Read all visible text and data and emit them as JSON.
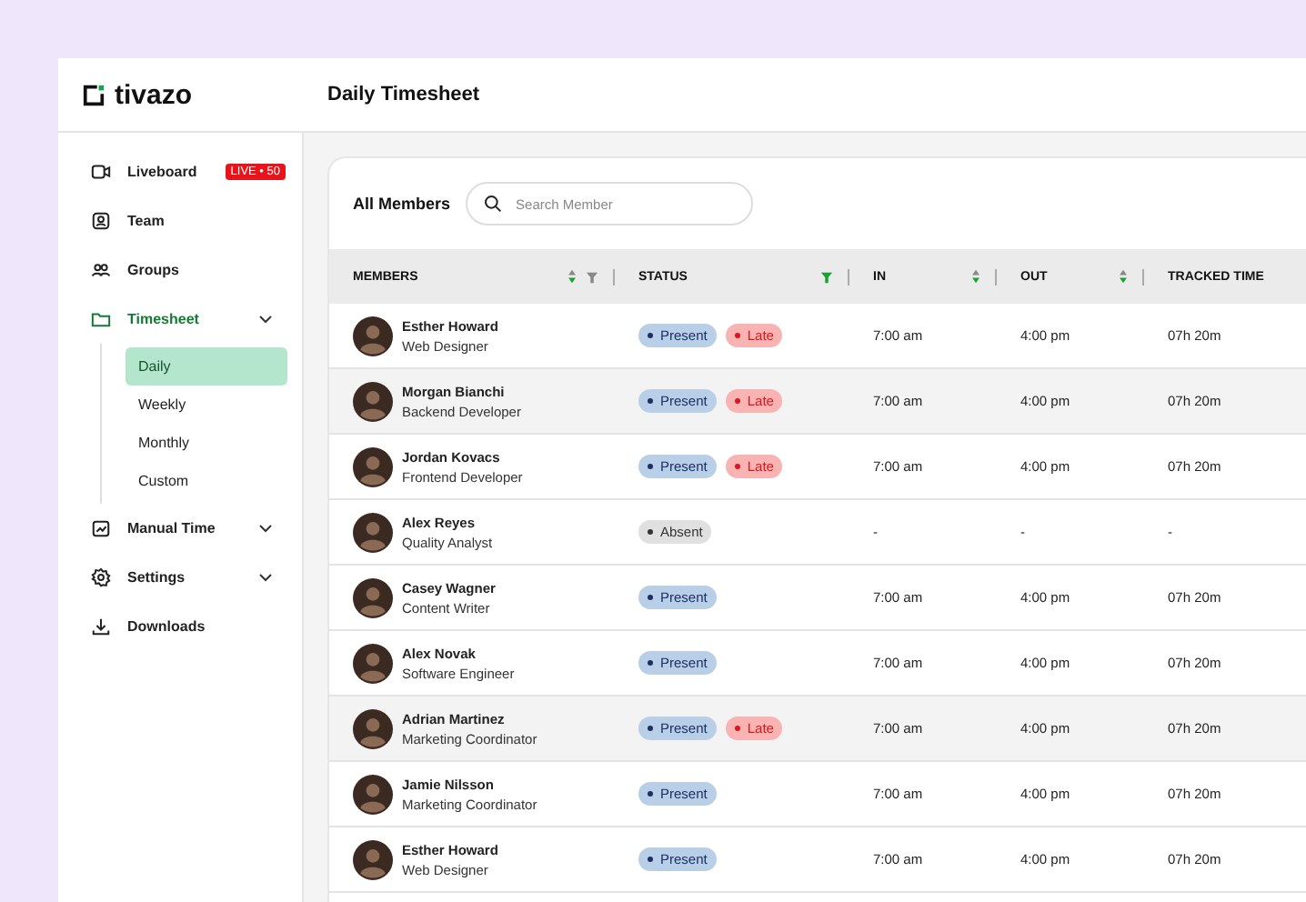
{
  "logo": {
    "text": "tivazo"
  },
  "header": {
    "title": "Daily Timesheet"
  },
  "sidebar": {
    "items": [
      {
        "label": "Liveboard",
        "badge": "LIVE • 50",
        "selected": false
      },
      {
        "label": "Team",
        "selected": false
      },
      {
        "label": "Groups",
        "selected": false
      },
      {
        "label": "Timesheet",
        "selected": true,
        "submenu": true,
        "expanded": true,
        "children": [
          {
            "label": "Daily",
            "selected": true
          },
          {
            "label": "Weekly",
            "selected": false
          },
          {
            "label": "Monthly",
            "selected": false
          },
          {
            "label": "Custom",
            "selected": false
          }
        ]
      },
      {
        "label": "Manual Time",
        "selected": false,
        "submenu": true
      },
      {
        "label": "Settings",
        "selected": false,
        "submenu": true
      },
      {
        "label": "Downloads",
        "selected": false
      }
    ]
  },
  "toolbar": {
    "title": "All Members",
    "search": {
      "placeholder": "Search Member"
    }
  },
  "table": {
    "columns": [
      {
        "label": "MEMBERS",
        "sort": true,
        "filter": true,
        "filter_active": false
      },
      {
        "label": "STATUS",
        "sort": false,
        "filter": true,
        "filter_active": true
      },
      {
        "label": "IN",
        "sort": true
      },
      {
        "label": "OUT",
        "sort": true
      },
      {
        "label": "TRACKED TIME"
      }
    ],
    "rows": [
      {
        "name": "Esther Howard",
        "role": "Web Designer",
        "selected": false,
        "status": [
          {
            "kind": "present",
            "label": "Present"
          },
          {
            "kind": "late",
            "label": "Late"
          }
        ],
        "in": "7:00 am",
        "out": "4:00 pm",
        "tracked": "07h 20m"
      },
      {
        "name": "Morgan Bianchi",
        "role": "Backend Developer",
        "selected": true,
        "status": [
          {
            "kind": "present",
            "label": "Present"
          },
          {
            "kind": "late",
            "label": "Late"
          }
        ],
        "in": "7:00 am",
        "out": "4:00 pm",
        "tracked": "07h 20m"
      },
      {
        "name": "Jordan Kovacs",
        "role": "Frontend Developer",
        "selected": false,
        "status": [
          {
            "kind": "present",
            "label": "Present"
          },
          {
            "kind": "late",
            "label": "Late"
          }
        ],
        "in": "7:00 am",
        "out": "4:00 pm",
        "tracked": "07h 20m"
      },
      {
        "name": "Alex Reyes",
        "role": "Quality Analyst",
        "selected": false,
        "status": [
          {
            "kind": "absent",
            "label": "Absent"
          }
        ],
        "in": "-",
        "out": "-",
        "tracked": "-"
      },
      {
        "name": "Casey Wagner",
        "role": "Content Writer",
        "selected": false,
        "status": [
          {
            "kind": "present",
            "label": "Present"
          }
        ],
        "in": "7:00 am",
        "out": "4:00 pm",
        "tracked": "07h 20m"
      },
      {
        "name": "Alex Novak",
        "role": "Software Engineer",
        "selected": false,
        "status": [
          {
            "kind": "present",
            "label": "Present"
          }
        ],
        "in": "7:00 am",
        "out": "4:00 pm",
        "tracked": "07h 20m"
      },
      {
        "name": "Adrian Martinez",
        "role": "Marketing Coordinator",
        "selected": true,
        "status": [
          {
            "kind": "present",
            "label": "Present"
          },
          {
            "kind": "late",
            "label": "Late"
          }
        ],
        "in": "7:00 am",
        "out": "4:00 pm",
        "tracked": "07h 20m"
      },
      {
        "name": "Jamie Nilsson",
        "role": "Marketing Coordinator",
        "selected": false,
        "status": [
          {
            "kind": "present",
            "label": "Present"
          }
        ],
        "in": "7:00 am",
        "out": "4:00 pm",
        "tracked": "07h 20m"
      },
      {
        "name": "Esther Howard",
        "role": "Web Designer",
        "selected": false,
        "status": [
          {
            "kind": "present",
            "label": "Present"
          }
        ],
        "in": "7:00 am",
        "out": "4:00 pm",
        "tracked": "07h 20m"
      }
    ]
  }
}
